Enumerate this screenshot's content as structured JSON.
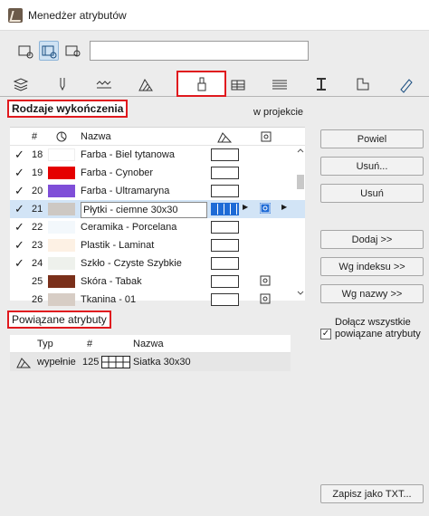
{
  "window": {
    "title": "Menedżer atrybutów"
  },
  "search": {
    "value": ""
  },
  "tabs": [
    "layers-icon",
    "pen-icon",
    "line-type-icon",
    "fill-icon",
    "surface-icon",
    "composite-icon",
    "profile-icon",
    "zone-icon",
    "building-material-icon",
    "marker-icon"
  ],
  "section": {
    "title": "Rodzaje wykończenia",
    "in_project": "w projekcie"
  },
  "list": {
    "headers": {
      "num": "#",
      "name": "Nazwa"
    },
    "rows": [
      {
        "check": "✓",
        "num": "18",
        "color": "#ffffff",
        "name": "Farba - Biel tytanowa",
        "ic": ""
      },
      {
        "check": "✓",
        "num": "19",
        "color": "#e50000",
        "name": "Farba - Cynober",
        "ic": ""
      },
      {
        "check": "✓",
        "num": "20",
        "color": "#7f4ed8",
        "name": "Farba - Ultramaryna",
        "ic": ""
      },
      {
        "check": "✓",
        "num": "21",
        "color": "#cdc8c3",
        "name": "Płytki - ciemne 30x30",
        "ic": "x",
        "sel": true
      },
      {
        "check": "✓",
        "num": "22",
        "color": "#f3f8fc",
        "name": "Ceramika - Porcelana",
        "ic": ""
      },
      {
        "check": "✓",
        "num": "23",
        "color": "#fdf1e4",
        "name": "Plastik - Laminat",
        "ic": ""
      },
      {
        "check": "✓",
        "num": "24",
        "color": "#eef1ec",
        "name": "Szkło - Czyste Szybkie",
        "ic": ""
      },
      {
        "check": "",
        "num": "25",
        "color": "#7a2f1a",
        "name": "Skóra - Tabak",
        "ic": "x"
      },
      {
        "check": "",
        "num": "26",
        "color": "#d7cdc5",
        "name": "Tkanina - 01",
        "ic": "x"
      }
    ]
  },
  "buttons": {
    "duplicate": "Powiel",
    "delete": "Usuń...",
    "remove": "Usuń",
    "add": "Dodaj >>",
    "by_index": "Wg indeksu >>",
    "by_name": "Wg nazwy >>",
    "save_txt": "Zapisz jako TXT..."
  },
  "related": {
    "title": "Powiązane atrybuty",
    "headers": {
      "type": "Typ",
      "num": "#",
      "name": "Nazwa"
    },
    "row": {
      "type": "wypełnie",
      "num": "125",
      "name": "Siatka 30x30"
    }
  },
  "include": {
    "checked": true,
    "label": "Dołącz wszystkie powiązane atrybuty"
  }
}
